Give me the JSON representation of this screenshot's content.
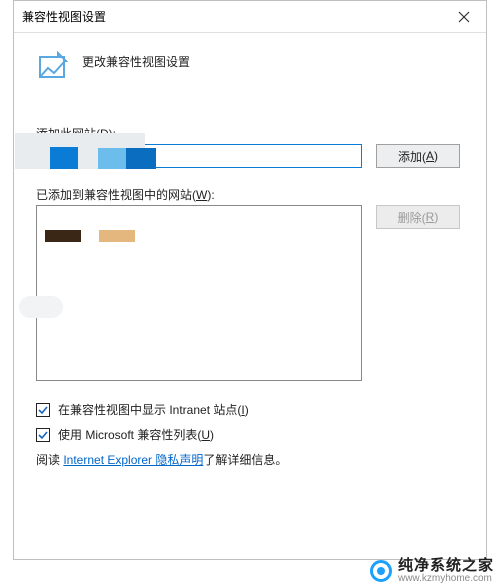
{
  "titlebar": {
    "title": "兼容性视图设置"
  },
  "header": {
    "text": "更改兼容性视图设置"
  },
  "add_section": {
    "label_pre": "添加此网站(",
    "label_key": "D",
    "label_post": "):",
    "button_pre": "添加(",
    "button_key": "A",
    "button_post": ")"
  },
  "list_section": {
    "label_pre": "已添加到兼容性视图中的网站(",
    "label_key": "W",
    "label_post": "):",
    "remove_pre": "删除(",
    "remove_key": "R",
    "remove_post": ")"
  },
  "checks": {
    "intranet_pre": "在兼容性视图中显示 Intranet 站点(",
    "intranet_key": "I",
    "intranet_post": ")",
    "mslist_pre": "使用 Microsoft 兼容性列表(",
    "mslist_key": "U",
    "mslist_post": ")"
  },
  "note": {
    "prefix": "阅读 ",
    "link": "Internet Explorer 隐私声明",
    "suffix": "了解详细信息。"
  },
  "watermark": {
    "cn": "纯净系统之家",
    "url": "www.kzmyhome.com"
  }
}
